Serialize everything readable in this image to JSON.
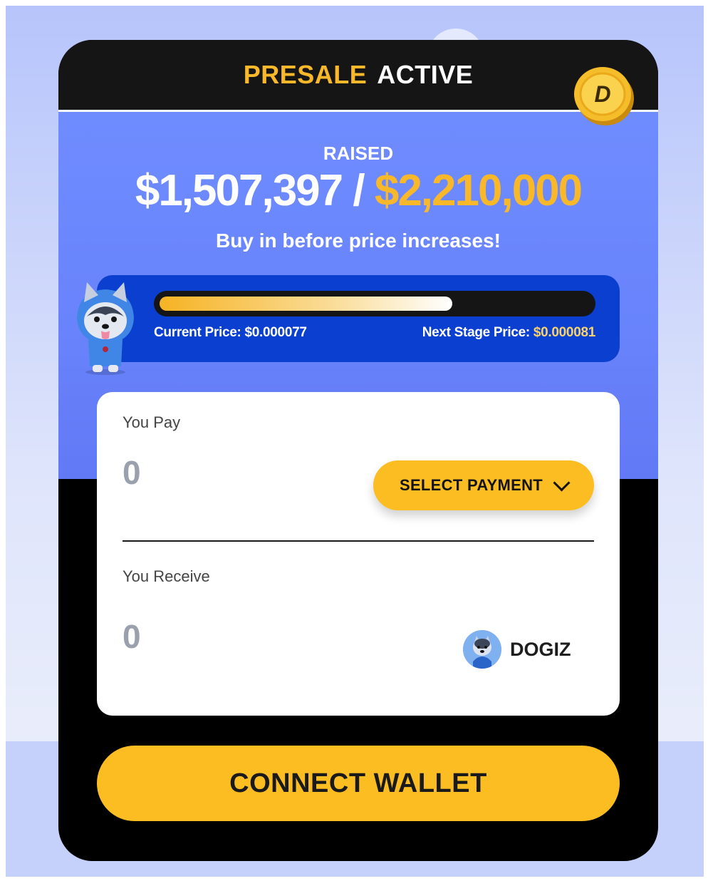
{
  "header": {
    "presale_word": "PRESALE",
    "active_word": "ACTIVE"
  },
  "raised": {
    "label": "RAISED",
    "current": "$1,507,397",
    "separator": " / ",
    "goal": "$2,210,000",
    "subtext": "Buy in before price increases!",
    "progress_fraction": 0.68
  },
  "prices": {
    "current_label": "Current Price:",
    "current_value": "$0.000077",
    "next_label": "Next Stage Price:",
    "next_value": "$0.000081"
  },
  "form": {
    "pay_label": "You Pay",
    "pay_value": "0",
    "select_payment_label": "SELECT PAYMENT",
    "receive_label": "You Receive",
    "receive_value": "0",
    "token_name": "DOGIZ"
  },
  "connect_wallet_label": "CONNECT WALLET",
  "icons": {
    "coin": "dogiz-coin-icon",
    "mascot": "husky-mascot-image",
    "chevron": "chevron-down-icon"
  },
  "colors": {
    "accent": "#fcbd22",
    "panel_blue": "#6f8cff",
    "price_box": "#0b3fcf"
  }
}
